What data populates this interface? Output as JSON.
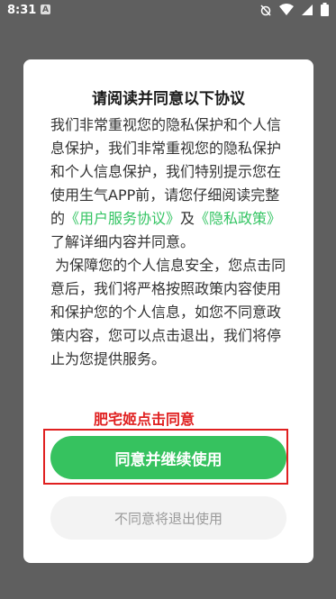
{
  "status_bar": {
    "time": "8:31",
    "app_icon_letter": "A",
    "icons": [
      "alarm-off-icon",
      "wifi-icon",
      "signal-icon",
      "battery-icon"
    ]
  },
  "dialog": {
    "title": "请阅读并同意以下协议",
    "paragraph1": {
      "intro": "我们非常重视您的隐私保护和个人信息保护，我们非常重视您的隐私保护和个人信息保护，我们特别提示您在使用生气APP前，请您仔细阅读完整的",
      "link1": "《用户服务协议》",
      "and": "及",
      "link2": "《隐私政策》",
      "outro": "了解详细内容并同意。"
    },
    "paragraph2": " 为保障您的个人信息安全，您点击同意后，我们将严格按照政策内容使用和保护您的个人信息，如您不同意政策内容，您可以点击退出，我们将停止为您提供服务。",
    "agree_label": "同意并继续使用",
    "decline_label": "不同意将退出使用"
  },
  "annotation": {
    "text": "肥宅姬点击同意"
  },
  "colors": {
    "accent": "#36c25f",
    "link": "#34c463",
    "annotation": "#e02020",
    "overlay": "#5f5f5f"
  }
}
